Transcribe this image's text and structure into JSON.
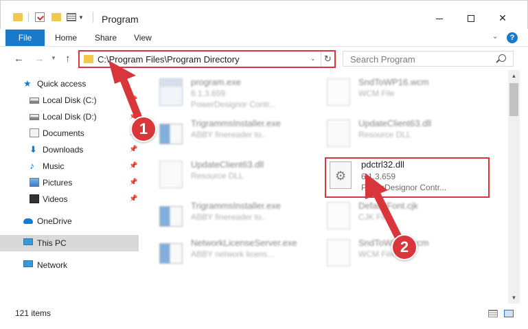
{
  "window": {
    "title": "Program",
    "minimize_glyph": "",
    "close_glyph": "✕"
  },
  "ribbon": {
    "file": "File",
    "tabs": [
      "Home",
      "Share",
      "View"
    ],
    "help": "?"
  },
  "address": {
    "path": "C:\\Program Files\\Program Directory",
    "search_placeholder": "Search Program"
  },
  "sidebar": {
    "items": [
      {
        "label": "Quick access",
        "icon": "star-icon"
      },
      {
        "label": "Local Disk (C:)",
        "icon": "drive-icon"
      },
      {
        "label": "Local Disk (D:)",
        "icon": "drive-icon"
      },
      {
        "label": "Documents",
        "icon": "documents-icon"
      },
      {
        "label": "Downloads",
        "icon": "downloads-icon"
      },
      {
        "label": "Music",
        "icon": "music-icon"
      },
      {
        "label": "Pictures",
        "icon": "pictures-icon"
      },
      {
        "label": "Videos",
        "icon": "videos-icon"
      },
      {
        "label": "OneDrive",
        "icon": "cloud-icon"
      },
      {
        "label": "This PC",
        "icon": "computer-icon"
      },
      {
        "label": "Network",
        "icon": "network-icon"
      }
    ]
  },
  "files": [
    {
      "name": "program.exe",
      "line2": "6.1.3.659",
      "line3": "PowerDesignor Contr..."
    },
    {
      "name": "SndToWP16.wcm",
      "line2": "WCM File",
      "line3": ""
    },
    {
      "name": "TrigrammsInstaller.exe",
      "line2": "ABBY finereader to..",
      "line3": ""
    },
    {
      "name": "UpdateClient63.dll",
      "line2": "Resource DLL",
      "line3": ""
    },
    {
      "name": "UpdateClient63.dll",
      "line2": "Resource DLL",
      "line3": ""
    },
    {
      "name": "TrigrammsInstaller.exe",
      "line2": "ABBY finereader to..",
      "line3": ""
    },
    {
      "name": "DefaultFont.cjk",
      "line2": "CJK File",
      "line3": ""
    },
    {
      "name": "NetworkLicenseServer.exe",
      "line2": "ABBY network licens...",
      "line3": ""
    },
    {
      "name": "SndToWP16.wcm",
      "line2": "WCM File",
      "line3": ""
    }
  ],
  "focused_file": {
    "name": "pdctrl32.dll",
    "version": "6.1.3.659",
    "company": "PowerDesignor Contr..."
  },
  "annotations": {
    "step1": "1",
    "step2": "2",
    "color": "#d8363a"
  },
  "status": {
    "item_count": "121 items"
  }
}
